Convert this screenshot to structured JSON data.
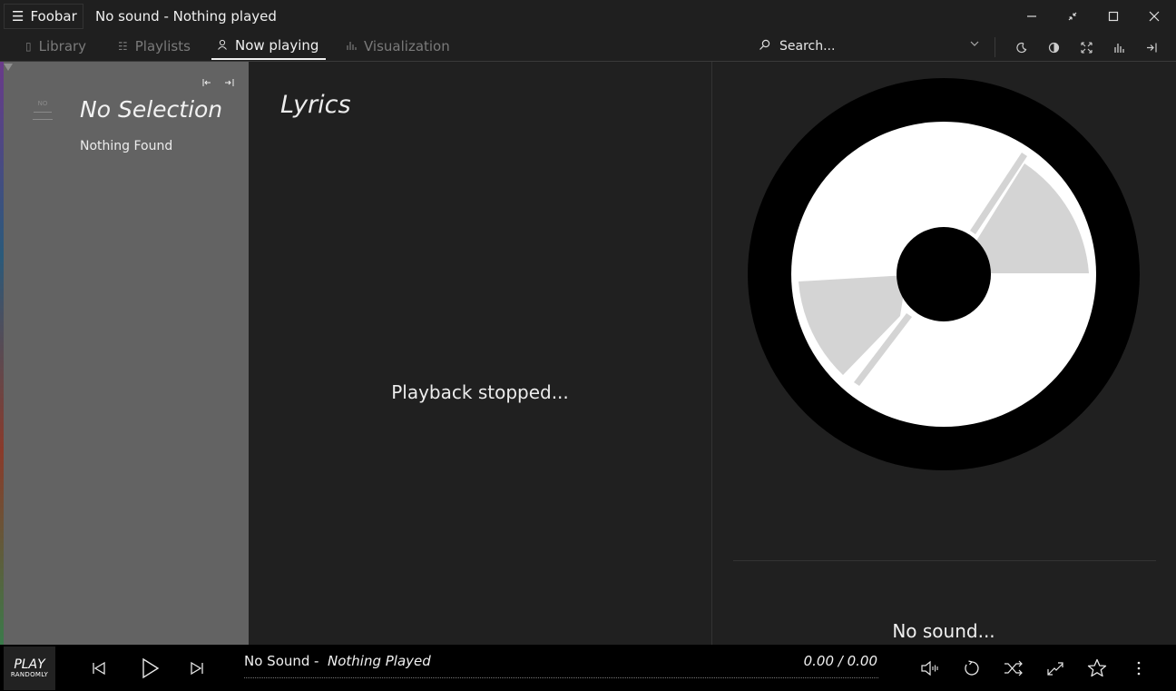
{
  "window": {
    "app_button": "Foobar",
    "title": "No sound - Nothing played",
    "controls": {
      "minimize": "minimize-icon",
      "compact": "compact-icon",
      "maximize": "maximize-icon",
      "close": "close-icon"
    }
  },
  "tabs": [
    {
      "label": "Library",
      "icon": "library-icon",
      "active": false
    },
    {
      "label": "Playlists",
      "icon": "playlist-icon",
      "active": false
    },
    {
      "label": "Now playing",
      "icon": "person-icon",
      "active": true
    },
    {
      "label": "Visualization",
      "icon": "bars-icon",
      "active": false
    }
  ],
  "search": {
    "placeholder": "Search..."
  },
  "toolbar_icons": [
    "moon-icon",
    "contrast-icon",
    "fullscreen-icon",
    "equalizer-icon",
    "exit-icon"
  ],
  "left_panel": {
    "no_art": "NO",
    "title": "No Selection",
    "subtitle": "Nothing Found"
  },
  "lyrics": {
    "title": "Lyrics",
    "status": "Playback stopped..."
  },
  "art_panel": {
    "caption": "No sound..."
  },
  "player": {
    "play_randomly": {
      "line1": "PLAY",
      "line2": "RANDOMLY"
    },
    "artist": "No Sound",
    "separator": "-",
    "track": "Nothing Played",
    "time": "0.00 / 0.00",
    "progress": 0
  },
  "colors": {
    "background": "#202020",
    "left_panel": "#636363",
    "bottom_bar": "#000000",
    "accent": "#f0f0f0"
  }
}
